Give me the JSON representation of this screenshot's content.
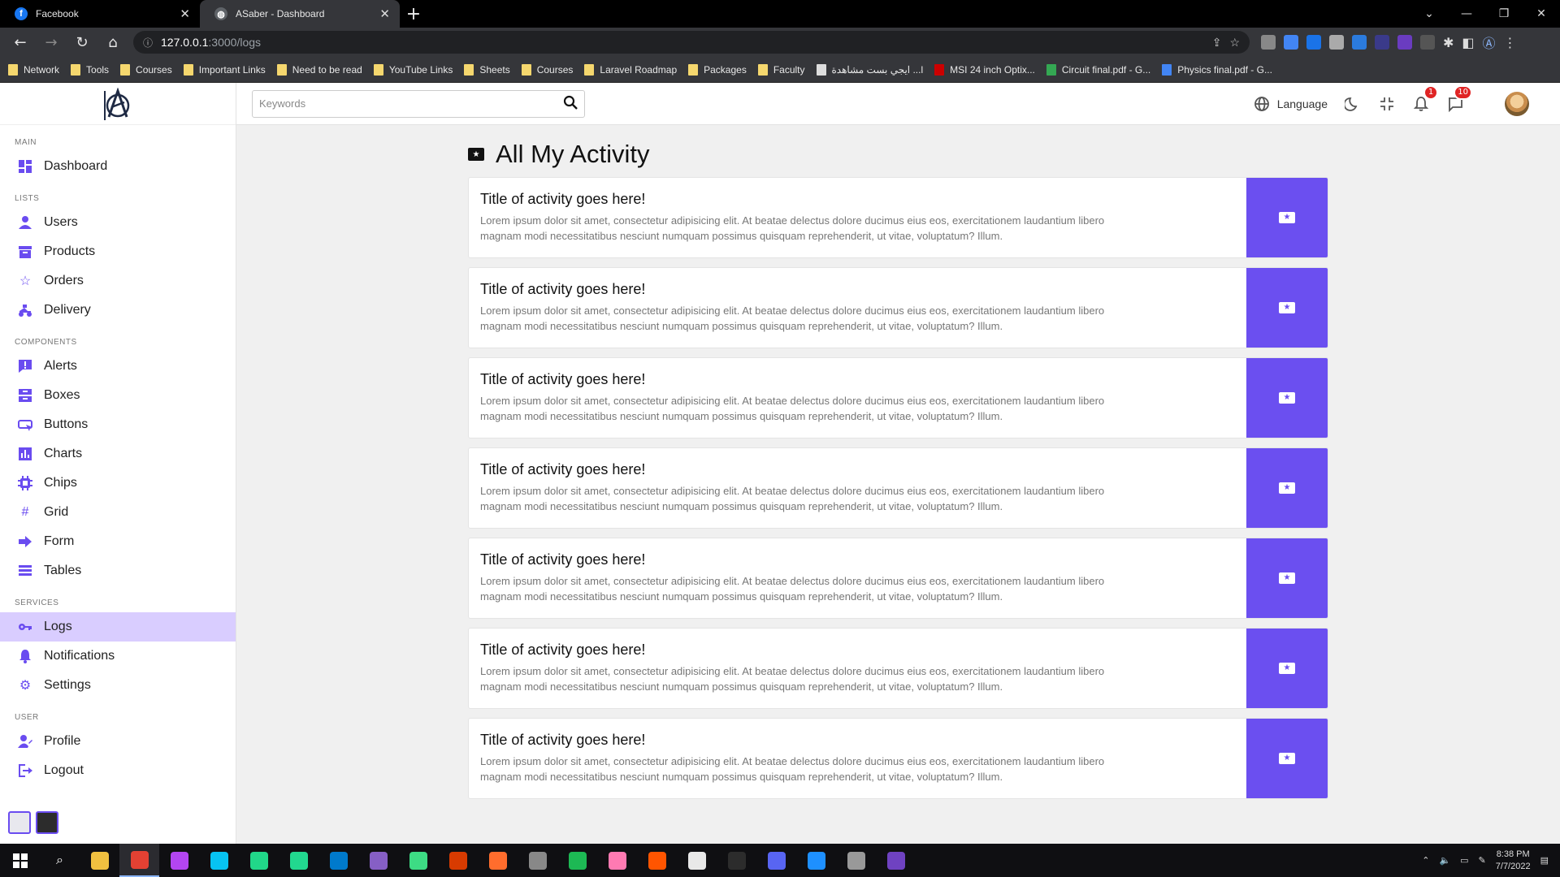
{
  "browser": {
    "tabs": [
      {
        "title": "Facebook",
        "active": false,
        "favicon": "facebook-icon",
        "favicon_color": "#1877f2"
      },
      {
        "title": "ASaber - Dashboard",
        "active": true,
        "favicon": "globe-icon",
        "favicon_color": "#9aa0a6"
      }
    ],
    "url_host": "127.0.0.1",
    "url_path": ":3000/logs",
    "bookmarks": [
      "Network",
      "Tools",
      "Courses",
      "Important Links",
      "Need to be read",
      "YouTube Links",
      "Sheets",
      "Courses",
      "Laravel Roadmap",
      "Packages",
      "Faculty",
      "ايجي بست مشاهدة ...l",
      "MSI 24 inch Optix...",
      "Circuit final.pdf - G...",
      "Physics final.pdf - G..."
    ]
  },
  "theme": {
    "accent": "#6b4ff0",
    "active_nav_bg": "#d9cdff",
    "badge": "#e02424"
  },
  "sidebar": {
    "sections": [
      {
        "title": "MAIN",
        "items": [
          {
            "label": "Dashboard",
            "icon": "dashboard-icon"
          }
        ]
      },
      {
        "title": "LISTS",
        "items": [
          {
            "label": "Users",
            "icon": "user-icon"
          },
          {
            "label": "Products",
            "icon": "box-icon"
          },
          {
            "label": "Orders",
            "icon": "star-icon"
          },
          {
            "label": "Delivery",
            "icon": "delivery-icon"
          }
        ]
      },
      {
        "title": "COMPONENTS",
        "items": [
          {
            "label": "Alerts",
            "icon": "alert-icon"
          },
          {
            "label": "Boxes",
            "icon": "inbox-icon"
          },
          {
            "label": "Buttons",
            "icon": "button-icon"
          },
          {
            "label": "Charts",
            "icon": "chart-icon"
          },
          {
            "label": "Chips",
            "icon": "chip-icon"
          },
          {
            "label": "Grid",
            "icon": "grid-icon"
          },
          {
            "label": "Form",
            "icon": "arrow-right-icon"
          },
          {
            "label": "Tables",
            "icon": "table-icon"
          }
        ]
      },
      {
        "title": "SERVICES",
        "items": [
          {
            "label": "Logs",
            "icon": "key-icon",
            "active": true
          },
          {
            "label": "Notifications",
            "icon": "bell-icon"
          },
          {
            "label": "Settings",
            "icon": "gear-icon"
          }
        ]
      },
      {
        "title": "USER",
        "items": [
          {
            "label": "Profile",
            "icon": "profile-icon"
          },
          {
            "label": "Logout",
            "icon": "logout-icon"
          }
        ]
      }
    ]
  },
  "topbar": {
    "search_placeholder": "Keywords",
    "language_label": "Language",
    "notifications_count": "1",
    "messages_count": "10"
  },
  "main": {
    "title": "All My Activity",
    "activities": [
      {
        "title": "Title of activity goes here!",
        "text": "Lorem ipsum dolor sit amet, consectetur adipisicing elit. At beatae delectus dolore ducimus eius eos, exercitationem laudantium libero magnam modi necessitatibus nesciunt numquam possimus quisquam reprehenderit, ut vitae, voluptatum? Illum."
      },
      {
        "title": "Title of activity goes here!",
        "text": "Lorem ipsum dolor sit amet, consectetur adipisicing elit. At beatae delectus dolore ducimus eius eos, exercitationem laudantium libero magnam modi necessitatibus nesciunt numquam possimus quisquam reprehenderit, ut vitae, voluptatum? Illum."
      },
      {
        "title": "Title of activity goes here!",
        "text": "Lorem ipsum dolor sit amet, consectetur adipisicing elit. At beatae delectus dolore ducimus eius eos, exercitationem laudantium libero magnam modi necessitatibus nesciunt numquam possimus quisquam reprehenderit, ut vitae, voluptatum? Illum."
      },
      {
        "title": "Title of activity goes here!",
        "text": "Lorem ipsum dolor sit amet, consectetur adipisicing elit. At beatae delectus dolore ducimus eius eos, exercitationem laudantium libero magnam modi necessitatibus nesciunt numquam possimus quisquam reprehenderit, ut vitae, voluptatum? Illum."
      },
      {
        "title": "Title of activity goes here!",
        "text": "Lorem ipsum dolor sit amet, consectetur adipisicing elit. At beatae delectus dolore ducimus eius eos, exercitationem laudantium libero magnam modi necessitatibus nesciunt numquam possimus quisquam reprehenderit, ut vitae, voluptatum? Illum."
      },
      {
        "title": "Title of activity goes here!",
        "text": "Lorem ipsum dolor sit amet, consectetur adipisicing elit. At beatae delectus dolore ducimus eius eos, exercitationem laudantium libero magnam modi necessitatibus nesciunt numquam possimus quisquam reprehenderit, ut vitae, voluptatum? Illum."
      },
      {
        "title": "Title of activity goes here!",
        "text": "Lorem ipsum dolor sit amet, consectetur adipisicing elit. At beatae delectus dolore ducimus eius eos, exercitationem laudantium libero magnam modi necessitatibus nesciunt numquam possimus quisquam reprehenderit, ut vitae, voluptatum? Illum."
      }
    ]
  },
  "taskbar": {
    "time": "8:38 PM",
    "date": "7/7/2022",
    "apps": [
      {
        "name": "file-explorer-icon",
        "color": "#f0c040"
      },
      {
        "name": "chrome-icon",
        "color": "#e34133",
        "active": true
      },
      {
        "name": "phpstorm-icon",
        "color": "#b345f1"
      },
      {
        "name": "webstorm-icon",
        "color": "#07c3f2"
      },
      {
        "name": "pycharm-icon",
        "color": "#21d789"
      },
      {
        "name": "clion-icon",
        "color": "#22d88f"
      },
      {
        "name": "vscode-icon",
        "color": "#007acc"
      },
      {
        "name": "visual-studio-icon",
        "color": "#865fc5"
      },
      {
        "name": "app-green-icon",
        "color": "#3ddc84"
      },
      {
        "name": "app-tiles-icon",
        "color": "#d83b01"
      },
      {
        "name": "app-orange-icon",
        "color": "#ff6d2d"
      },
      {
        "name": "app-gray-icon",
        "color": "#888888"
      },
      {
        "name": "app-circle-icon",
        "color": "#1db954"
      },
      {
        "name": "app-cloud-icon",
        "color": "#ff7ab2"
      },
      {
        "name": "soundcloud-icon",
        "color": "#ff5500"
      },
      {
        "name": "app-white-icon",
        "color": "#e8e8e8"
      },
      {
        "name": "app-dark-icon",
        "color": "#2c2c2c"
      },
      {
        "name": "discord-icon",
        "color": "#5865f2"
      },
      {
        "name": "app-blue-icon",
        "color": "#1e90ff"
      },
      {
        "name": "app-box-icon",
        "color": "#999999"
      },
      {
        "name": "app-purple-icon",
        "color": "#6f42c1"
      }
    ]
  }
}
